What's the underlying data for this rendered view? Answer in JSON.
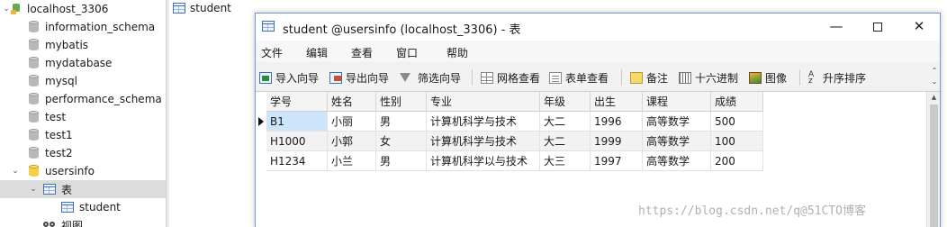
{
  "tree": {
    "connection": "localhost_3306",
    "databases": [
      "information_schema",
      "mybatis",
      "mydatabase",
      "mysql",
      "performance_schema",
      "test",
      "test1",
      "test2"
    ],
    "open_database": "usersinfo",
    "tables_group": "表",
    "table": "student",
    "views_group": "视图"
  },
  "object_tab": "student",
  "window": {
    "title": "student @usersinfo (localhost_3306) - 表",
    "minimize": "—",
    "close": "✕"
  },
  "menu": [
    "文件",
    "编辑",
    "查看",
    "窗口",
    "帮助"
  ],
  "toolbar": [
    "导入向导",
    "导出向导",
    "筛选向导",
    "网格查看",
    "表单查看",
    "备注",
    "十六进制",
    "图像",
    "升序排序"
  ],
  "grid": {
    "columns": [
      "学号",
      "姓名",
      "性别",
      "专业",
      "年级",
      "出生",
      "课程",
      "成绩"
    ],
    "rows": [
      [
        "B1",
        "小丽",
        "男",
        "计算机科学与技术",
        "大二",
        "1996",
        "高等数学",
        "500"
      ],
      [
        "H1000",
        "小郭",
        "女",
        "计算机科学与技术",
        "大二",
        "1999",
        "高等数学",
        "100"
      ],
      [
        "H1234",
        "小兰",
        "男",
        "计算机科学以与技术",
        "大三",
        "1997",
        "高等数学",
        "200"
      ]
    ]
  },
  "watermark": "https://blog.csdn.net/q@51CTO博客",
  "colors": {
    "selected_cell": "#cde5fb",
    "tree_selected": "#dcdcdc",
    "window_border": "#6e9ad2"
  }
}
